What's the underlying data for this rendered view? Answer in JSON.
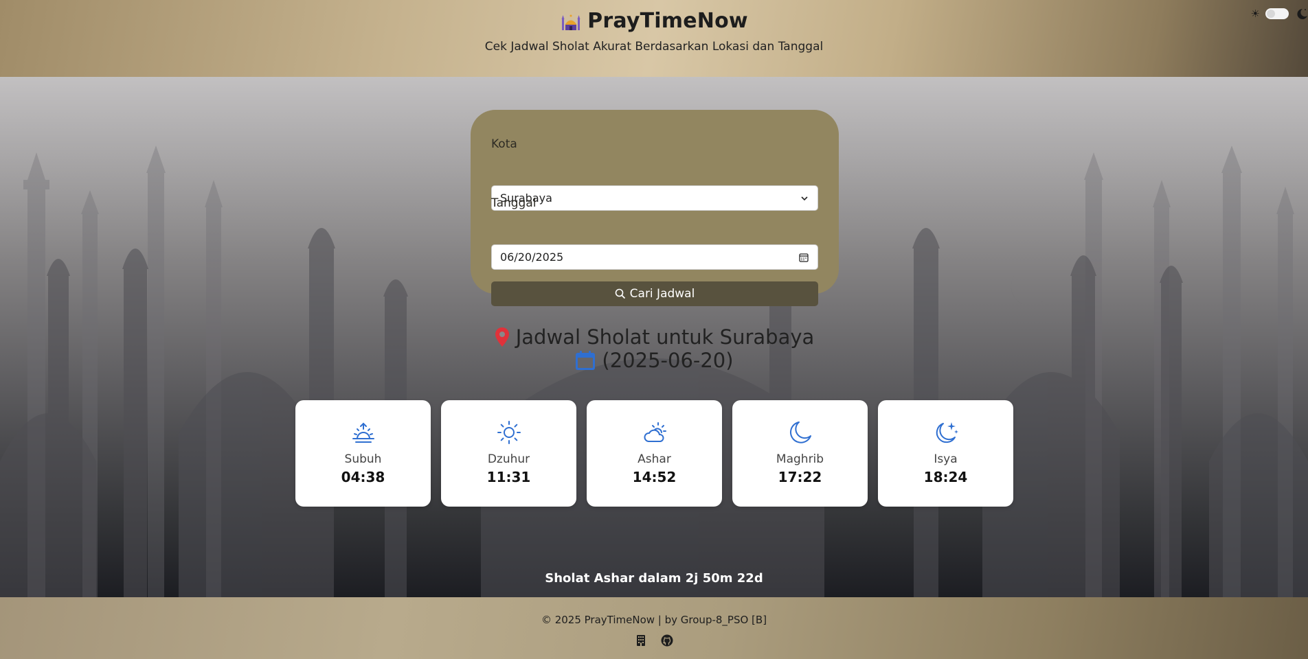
{
  "header": {
    "title": "PrayTimeNow",
    "subtitle": "Cek Jadwal Sholat Akurat Berdasarkan Lokasi dan Tanggal",
    "brand_icon": "mosque-icon",
    "theme": {
      "sun": "☀",
      "mode": "light"
    }
  },
  "form": {
    "city_label": "Kota",
    "city_value": "Surabaya",
    "date_label": "Tanggal",
    "date_value": "06/20/2025",
    "search_label": "Cari Jadwal"
  },
  "result": {
    "heading_line1": "Jadwal Sholat untuk Surabaya",
    "heading_line2": "(2025-06-20)",
    "prayers": [
      {
        "name": "Subuh",
        "time": "04:38",
        "icon": "sunrise-icon"
      },
      {
        "name": "Dzuhur",
        "time": "11:31",
        "icon": "sun-icon"
      },
      {
        "name": "Ashar",
        "time": "14:52",
        "icon": "cloud-sun-icon"
      },
      {
        "name": "Maghrib",
        "time": "17:22",
        "icon": "moon-icon"
      },
      {
        "name": "Isya",
        "time": "18:24",
        "icon": "moon-stars-icon"
      }
    ],
    "countdown": "Sholat Ashar dalam 2j 50m 22d"
  },
  "footer": {
    "text": "© 2025 PrayTimeNow | by Group-8_PSO [B]"
  },
  "colors": {
    "accent_blue": "#2f6fd1",
    "pin_red": "#e0323a",
    "card_bg": "#928660",
    "button_bg": "#58523e"
  }
}
